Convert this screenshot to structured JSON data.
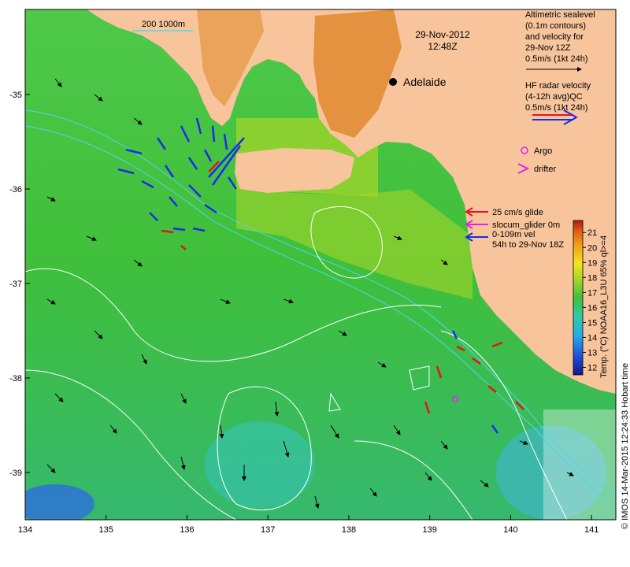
{
  "title": {
    "date": "29-Nov-2012",
    "time": "12:48Z"
  },
  "place_labels": [
    {
      "name": "Adelaide",
      "lon": 138.6,
      "lat": -34.93
    }
  ],
  "depth_contour_label": "200  1000m",
  "axes": {
    "x_ticks": [
      "134",
      "135",
      "136",
      "137",
      "138",
      "139",
      "140",
      "141"
    ],
    "y_ticks": [
      "-35",
      "-36",
      "-37",
      "-38",
      "-39"
    ],
    "lon_range": [
      134,
      141.3
    ],
    "lat_range": [
      -39.5,
      -34.1
    ]
  },
  "legend": {
    "altimetry": [
      "Altimetric sealevel",
      "(0.1m contours)",
      "and velocity for",
      "29-Nov 12Z",
      "0.5m/s (1kt 24h)"
    ],
    "hf_radar": [
      "HF radar velocity",
      "(4-12h avg)QC",
      "0.5m/s (1kt 24h)"
    ],
    "argo_label": "Argo",
    "drifter_label": "drifter",
    "glider": [
      "25 cm/s glide",
      "slocum_glider 0m",
      "0-109m vel",
      "54h to 29-Nov 18Z"
    ]
  },
  "colorbar": {
    "title": "Temp. (°C) NOAA16_L3U 65% ql>=4",
    "ticks": [
      "12",
      "13",
      "14",
      "15",
      "16",
      "17",
      "18",
      "19",
      "20",
      "21"
    ],
    "range": [
      11.5,
      21.8
    ]
  },
  "credit": "© IMOS 14-Mar-2015 12:24:33 Hobart time",
  "colors": {
    "land": "#f7c49c",
    "hf_radar_arrow": "#1a2ee6",
    "glider_red": "#e4141e",
    "glider_magenta": "#e623e6",
    "glider_blue": "#1a2ee6",
    "argo": "#e623e6",
    "contours": "#ffffff",
    "bathymetry": "#4fd6f0"
  }
}
